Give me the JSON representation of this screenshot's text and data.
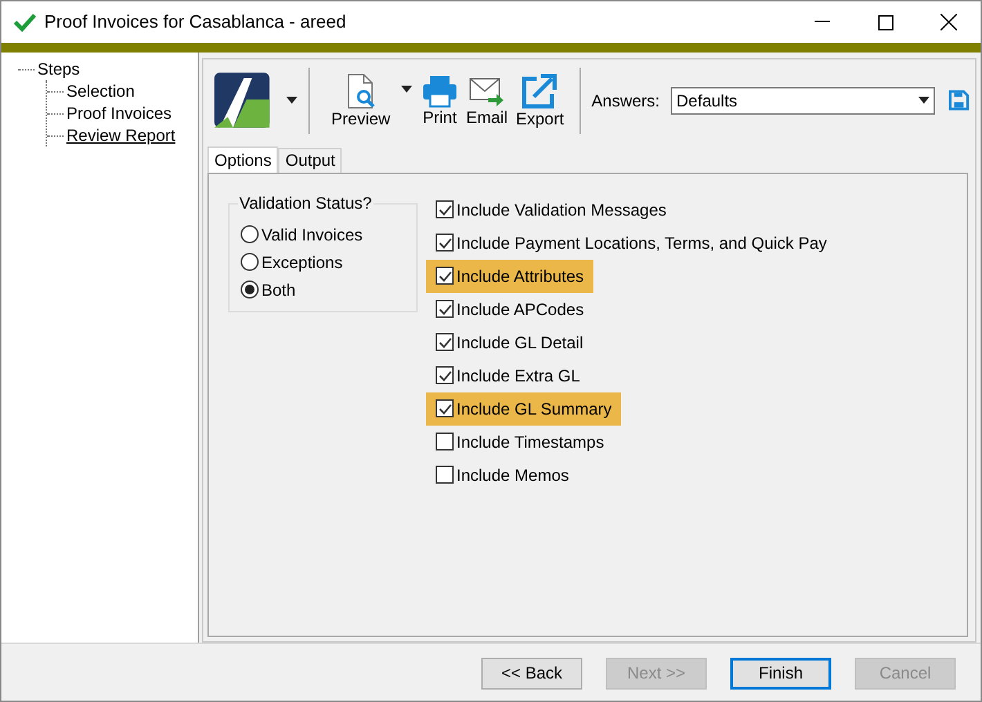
{
  "window": {
    "title": "Proof Invoices for Casablanca - areed"
  },
  "steps": {
    "label": "Steps",
    "children": [
      {
        "label": "Selection",
        "selected": false
      },
      {
        "label": "Proof Invoices",
        "selected": false
      },
      {
        "label": "Review Report",
        "selected": true
      }
    ]
  },
  "toolbar": {
    "buttons": [
      {
        "kind": "preview",
        "label": "Preview"
      },
      {
        "kind": "print",
        "label": "Print"
      },
      {
        "kind": "email",
        "label": "Email"
      },
      {
        "kind": "export",
        "label": "Export"
      }
    ],
    "answers_label": "Answers:",
    "answers_value": "Defaults"
  },
  "tabs": [
    {
      "label": "Options",
      "selected": true
    },
    {
      "label": "Output",
      "selected": false
    }
  ],
  "validation_status": {
    "title": "Validation Status?",
    "options": [
      {
        "label": "Valid Invoices",
        "selected": false
      },
      {
        "label": "Exceptions",
        "selected": false
      },
      {
        "label": "Both",
        "selected": true
      }
    ]
  },
  "options": [
    {
      "label": "Include Validation Messages",
      "checked": true,
      "highlighted": false
    },
    {
      "label": "Include Payment Locations, Terms, and Quick Pay",
      "checked": true,
      "highlighted": false
    },
    {
      "label": "Include Attributes",
      "checked": true,
      "highlighted": true
    },
    {
      "label": "Include APCodes",
      "checked": true,
      "highlighted": false
    },
    {
      "label": "Include GL Detail",
      "checked": true,
      "highlighted": false
    },
    {
      "label": "Include Extra GL",
      "checked": true,
      "highlighted": false
    },
    {
      "label": "Include GL Summary",
      "checked": true,
      "highlighted": true
    },
    {
      "label": "Include Timestamps",
      "checked": false,
      "highlighted": false
    },
    {
      "label": "Include Memos",
      "checked": false,
      "highlighted": false
    }
  ],
  "buttons": [
    {
      "label": "<< Back",
      "disabled": false,
      "default": false
    },
    {
      "label": "Next >>",
      "disabled": true,
      "default": false
    },
    {
      "label": "Finish",
      "disabled": false,
      "default": true
    },
    {
      "label": "Cancel",
      "disabled": true,
      "default": false
    }
  ]
}
